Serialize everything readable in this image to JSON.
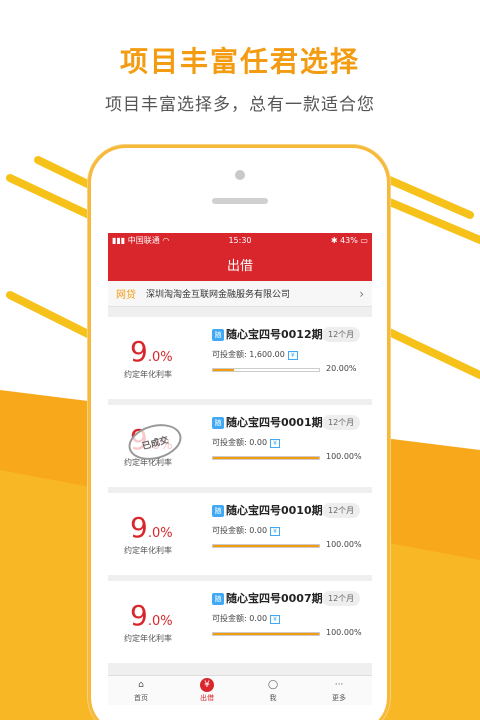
{
  "hero": {
    "headline": "项目丰富任君选择",
    "subheadline": "项目丰富选择多，总有一款适合您"
  },
  "status_bar": {
    "carrier": "中国联通",
    "time": "15:30",
    "battery": "43%"
  },
  "nav": {
    "title": "出借"
  },
  "provider": {
    "tag": "网贷",
    "name": "深圳淘淘金互联网金融服务有限公司",
    "chevron": "›"
  },
  "labels": {
    "rate_label": "约定年化利率",
    "available_prefix": "可投金额: ",
    "badge": "随",
    "yen": "¥",
    "sold_stamp": "已成交"
  },
  "products": [
    {
      "rate_int": "9",
      "rate_dec": ".0%",
      "name": "随心宝四号0012期",
      "term": "12个月",
      "available": "1,600.00",
      "progress": 0.2,
      "progress_text": "20.00%",
      "sold": false
    },
    {
      "rate_int": "9",
      "rate_dec": ".0%",
      "name": "随心宝四号0001期",
      "term": "12个月",
      "available": "0.00",
      "progress": 1.0,
      "progress_text": "100.00%",
      "sold": true
    },
    {
      "rate_int": "9",
      "rate_dec": ".0%",
      "name": "随心宝四号0010期",
      "term": "12个月",
      "available": "0.00",
      "progress": 1.0,
      "progress_text": "100.00%",
      "sold": false
    },
    {
      "rate_int": "9",
      "rate_dec": ".0%",
      "name": "随心宝四号0007期",
      "term": "12个月",
      "available": "0.00",
      "progress": 1.0,
      "progress_text": "100.00%",
      "sold": false
    }
  ],
  "tabs": [
    {
      "label": "首页",
      "icon": "home-icon",
      "active": false
    },
    {
      "label": "出借",
      "icon": "yen-icon",
      "active": true
    },
    {
      "label": "我",
      "icon": "user-icon",
      "active": false
    },
    {
      "label": "更多",
      "icon": "more-icon",
      "active": false
    }
  ],
  "colors": {
    "brand_red": "#d9262c",
    "accent_orange": "#f39c12",
    "info_blue": "#3fa9f5"
  }
}
